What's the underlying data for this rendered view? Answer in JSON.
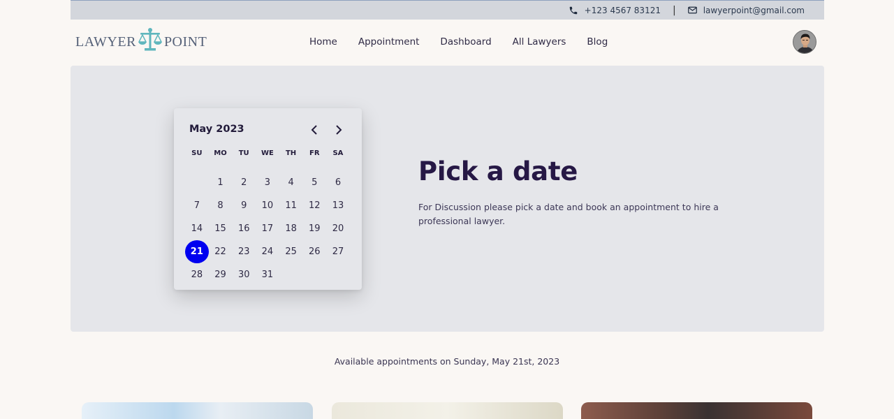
{
  "topbar": {
    "phone_icon": "phone-icon",
    "phone": "+123 4567 83121",
    "separator": "|",
    "mail_icon": "mail-icon",
    "email": "lawyerpoint@gmail.com"
  },
  "brand": {
    "left": "LAWYER",
    "right": "POINT",
    "logo_icon": "scales-of-justice-icon",
    "logo_color": "#5fb6bd"
  },
  "nav": {
    "home": "Home",
    "appointment": "Appointment",
    "dashboard": "Dashboard",
    "all_lawyers": "All Lawyers",
    "blog": "Blog"
  },
  "calendar": {
    "month_label": "May 2023",
    "weekdays": [
      "SU",
      "MO",
      "TU",
      "WE",
      "TH",
      "FR",
      "SA"
    ],
    "first_weekday_offset": 1,
    "days_in_month": 31,
    "selected_day": 21,
    "selected_color": "#0000f0"
  },
  "hero": {
    "title": "Pick a date",
    "description": "For Discussion please pick a date and book an appointment to hire a professional lawyer."
  },
  "availability": {
    "text": "Available appointments on Sunday, May 21st, 2023"
  },
  "colors": {
    "page_bg": "#faf7f4",
    "topbar_bg": "#d3d6dc",
    "hero_bg": "#e5e6ea",
    "title_color": "#261845"
  }
}
